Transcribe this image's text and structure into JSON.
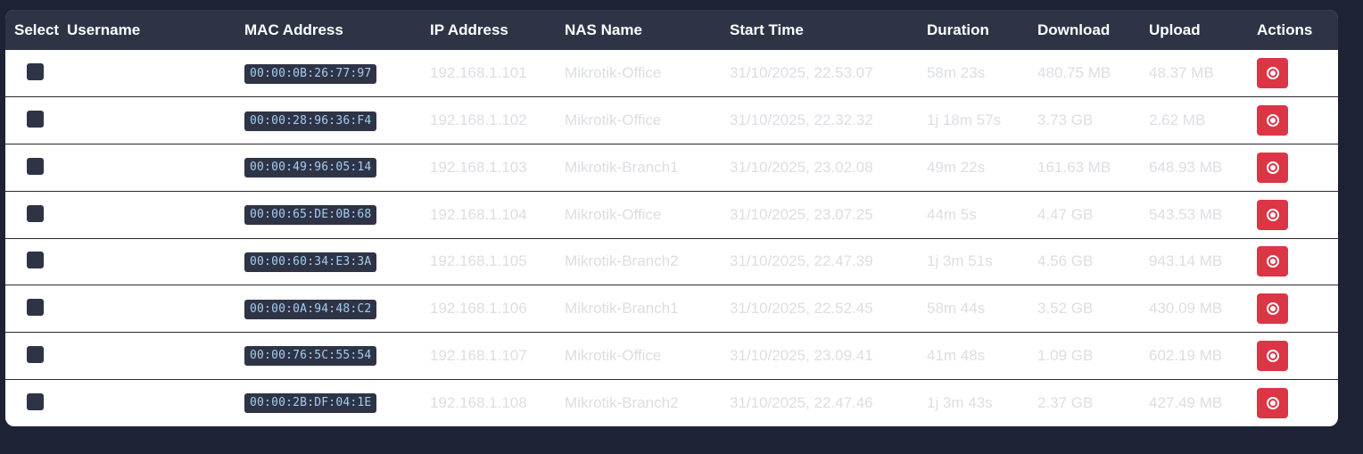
{
  "table": {
    "headers": {
      "select": "Select",
      "username": "Username",
      "mac": "MAC Address",
      "ip": "IP Address",
      "nas": "NAS Name",
      "start": "Start Time",
      "duration": "Duration",
      "download": "Download",
      "upload": "Upload",
      "actions": "Actions"
    },
    "rows": [
      {
        "username": "",
        "mac": "00:00:0B:26:77:97",
        "ip": "192.168.1.101",
        "nas": "Mikrotik-Office",
        "start": "31/10/2025, 22.53.07",
        "duration": "58m 23s",
        "download": "480.75 MB",
        "upload": "48.37 MB"
      },
      {
        "username": "",
        "mac": "00:00:28:96:36:F4",
        "ip": "192.168.1.102",
        "nas": "Mikrotik-Office",
        "start": "31/10/2025, 22.32.32",
        "duration": "1j 18m 57s",
        "download": "3.73 GB",
        "upload": "2.62 MB"
      },
      {
        "username": "",
        "mac": "00:00:49:96:05:14",
        "ip": "192.168.1.103",
        "nas": "Mikrotik-Branch1",
        "start": "31/10/2025, 23.02.08",
        "duration": "49m 22s",
        "download": "161.63 MB",
        "upload": "648.93 MB"
      },
      {
        "username": "",
        "mac": "00:00:65:DE:0B:68",
        "ip": "192.168.1.104",
        "nas": "Mikrotik-Office",
        "start": "31/10/2025, 23.07.25",
        "duration": "44m 5s",
        "download": "4.47 GB",
        "upload": "543.53 MB"
      },
      {
        "username": "",
        "mac": "00:00:60:34:E3:3A",
        "ip": "192.168.1.105",
        "nas": "Mikrotik-Branch2",
        "start": "31/10/2025, 22.47.39",
        "duration": "1j 3m 51s",
        "download": "4.56 GB",
        "upload": "943.14 MB"
      },
      {
        "username": "",
        "mac": "00:00:0A:94:48:C2",
        "ip": "192.168.1.106",
        "nas": "Mikrotik-Branch1",
        "start": "31/10/2025, 22.52.45",
        "duration": "58m 44s",
        "download": "3.52 GB",
        "upload": "430.09 MB"
      },
      {
        "username": "",
        "mac": "00:00:76:5C:55:54",
        "ip": "192.168.1.107",
        "nas": "Mikrotik-Office",
        "start": "31/10/2025, 23.09.41",
        "duration": "41m 48s",
        "download": "1.09 GB",
        "upload": "602.19 MB"
      },
      {
        "username": "",
        "mac": "00:00:2B:DF:04:1E",
        "ip": "192.168.1.108",
        "nas": "Mikrotik-Branch2",
        "start": "31/10/2025, 22.47.46",
        "duration": "1j 3m 43s",
        "download": "2.37 GB",
        "upload": "427.49 MB"
      }
    ],
    "row_icons": {
      "select": "checkbox-icon",
      "action": "stop-circle-icon"
    }
  },
  "colors": {
    "page_bg": "#1e2235",
    "header_bg": "#2e3446",
    "mac_badge_bg": "#2e3446",
    "mac_text": "#a6ccf0",
    "muted_text": "#dcdee2",
    "danger": "#dc3545"
  }
}
